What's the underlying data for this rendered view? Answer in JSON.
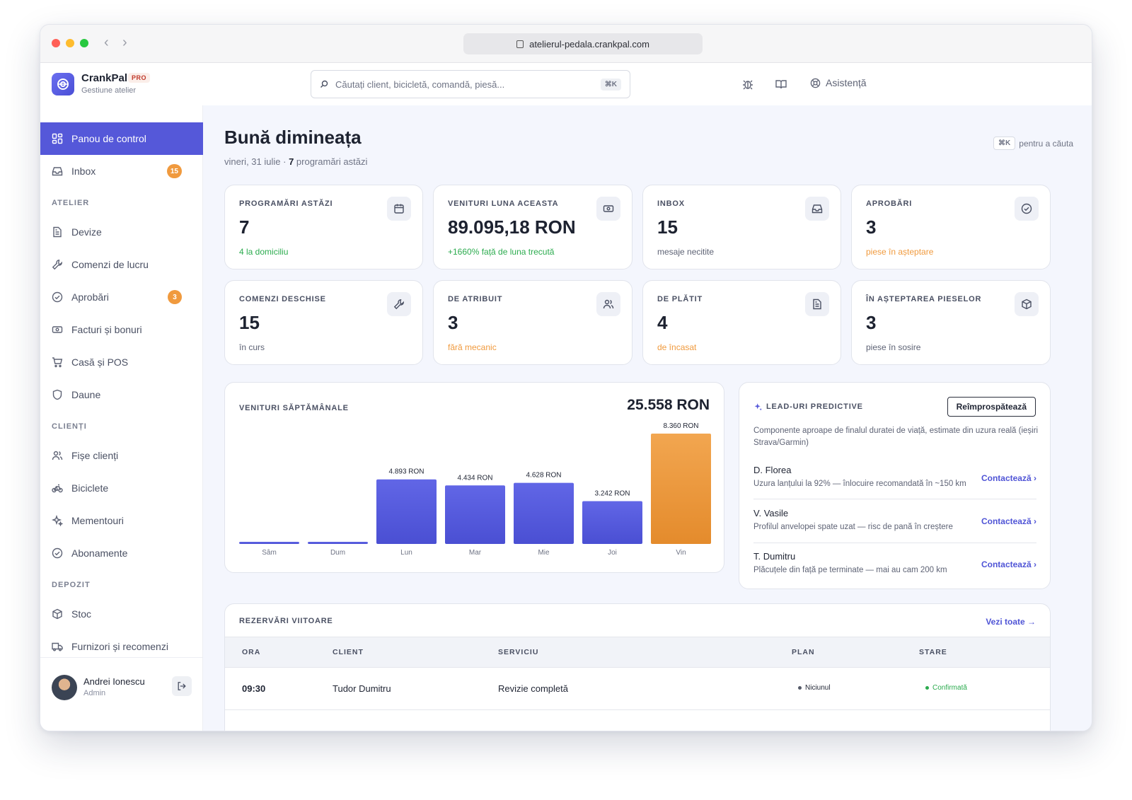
{
  "browser": {
    "url": "atelierul-pedala.crankpal.com"
  },
  "brand": {
    "name": "CrankPal",
    "badge": "PRO",
    "subtitle": "Gestiune atelier"
  },
  "search": {
    "placeholder": "Căutați client, bicicletă, comandă, piesă...",
    "shortcut": "⌘K"
  },
  "header": {
    "help_label": "Asistență"
  },
  "sidebar": {
    "top_items": [
      {
        "label": "Panou de control",
        "icon": "dashboard-icon",
        "active": true
      },
      {
        "label": "Inbox",
        "icon": "inbox-icon",
        "count": "15"
      }
    ],
    "sections": [
      {
        "title": "ATELIER",
        "items": [
          {
            "label": "Devize",
            "icon": "document-icon"
          },
          {
            "label": "Comenzi de lucru",
            "icon": "wrench-icon"
          },
          {
            "label": "Aprobări",
            "icon": "check-circle-icon",
            "count": "3"
          },
          {
            "label": "Facturi și bonuri",
            "icon": "banknote-icon"
          },
          {
            "label": "Casă și POS",
            "icon": "cart-icon"
          },
          {
            "label": "Daune",
            "icon": "shield-icon"
          }
        ]
      },
      {
        "title": "CLIENȚI",
        "items": [
          {
            "label": "Fișe clienți",
            "icon": "users-icon"
          },
          {
            "label": "Biciclete",
            "icon": "bicycle-icon"
          },
          {
            "label": "Mementouri",
            "icon": "sparkles-icon"
          },
          {
            "label": "Abonamente",
            "icon": "check-circle-icon"
          }
        ]
      },
      {
        "title": "DEPOZIT",
        "items": [
          {
            "label": "Stoc",
            "icon": "box-icon"
          },
          {
            "label": "Furnizori și recomenzi",
            "icon": "truck-icon"
          }
        ]
      }
    ],
    "user": {
      "name": "Andrei Ionescu",
      "role": "Admin"
    }
  },
  "greeting": {
    "title": "Bună dimineața",
    "date": "vineri, 31 iulie",
    "separator": " · ",
    "appointments_count": "7",
    "appointments_text": " programări astăzi",
    "hint_key": "⌘K",
    "hint_text": "pentru a căuta"
  },
  "stats": [
    {
      "label": "PROGRAMĂRI ASTĂZI",
      "value": "7",
      "sub": "4 la domiciliu",
      "tone": "green",
      "icon": "calendar-icon"
    },
    {
      "label": "VENITURI LUNA ACEASTA",
      "value": "89.095,18 RON",
      "sub": "+1660% față de luna trecută",
      "tone": "green",
      "icon": "banknote-icon"
    },
    {
      "label": "INBOX",
      "value": "15",
      "sub": "mesaje necitite",
      "tone": "grey",
      "icon": "inbox-icon"
    },
    {
      "label": "APROBĂRI",
      "value": "3",
      "sub": "piese în așteptare",
      "tone": "orange",
      "icon": "check-circle-icon"
    },
    {
      "label": "COMENZI DESCHISE",
      "value": "15",
      "sub": "în curs",
      "tone": "grey",
      "icon": "wrench-icon"
    },
    {
      "label": "DE ATRIBUIT",
      "value": "3",
      "sub": "fără mecanic",
      "tone": "orange",
      "icon": "users-icon"
    },
    {
      "label": "DE PLĂTIT",
      "value": "4",
      "sub": "de încasat",
      "tone": "orange",
      "icon": "document-icon"
    },
    {
      "label": "ÎN AȘTEPTAREA PIESELOR",
      "value": "3",
      "sub": "piese în sosire",
      "tone": "grey",
      "icon": "box-icon"
    }
  ],
  "chart_data": {
    "type": "bar",
    "title": "VENITURI SĂPTĂMÂNALE",
    "total": "25.558 RON",
    "categories": [
      "Sâm",
      "Dum",
      "Lun",
      "Mar",
      "Mie",
      "Joi",
      "Vin"
    ],
    "values": [
      0,
      0,
      4893,
      4434,
      4628,
      3242,
      8360
    ],
    "value_labels": [
      "",
      "",
      "4.893 RON",
      "4.434 RON",
      "4.628 RON",
      "3.242 RON",
      "8.360 RON"
    ],
    "highlight_index": 6,
    "colors": {
      "normal": "#5558d9",
      "highlight": "#f0a04b"
    },
    "ylim": [
      0,
      8360
    ]
  },
  "leads": {
    "title": "LEAD-URI PREDICTIVE",
    "refresh_label": "Reîmprospătează",
    "description": "Componente aproape de finalul duratei de viață, estimate din uzura reală (ieșiri Strava/Garmin)",
    "items": [
      {
        "name": "D. Florea",
        "info": "Uzura lanțului la 92% — înlocuire recomandată în ~150 km",
        "action": "Contactează ›"
      },
      {
        "name": "V. Vasile",
        "info": "Profilul anvelopei spate uzat — risc de pană în creștere",
        "action": "Contactează ›"
      },
      {
        "name": "T. Dumitru",
        "info": "Plăcuțele din față pe terminate — mai au cam 200 km",
        "action": "Contactează ›"
      }
    ]
  },
  "bookings": {
    "title": "REZERVĂRI VIITOARE",
    "view_all": "Vezi toate →",
    "columns": [
      "ORA",
      "CLIENT",
      "SERVICIU",
      "PLAN",
      "STARE"
    ],
    "rows": [
      {
        "time": "09:30",
        "client": "Tudor Dumitru",
        "service": "Revizie completă",
        "plan": "Niciunul",
        "status": "Confirmată"
      }
    ]
  },
  "colors": {
    "accent": "#5558d9",
    "orange": "#f09a3e",
    "green": "#2bab4e"
  }
}
